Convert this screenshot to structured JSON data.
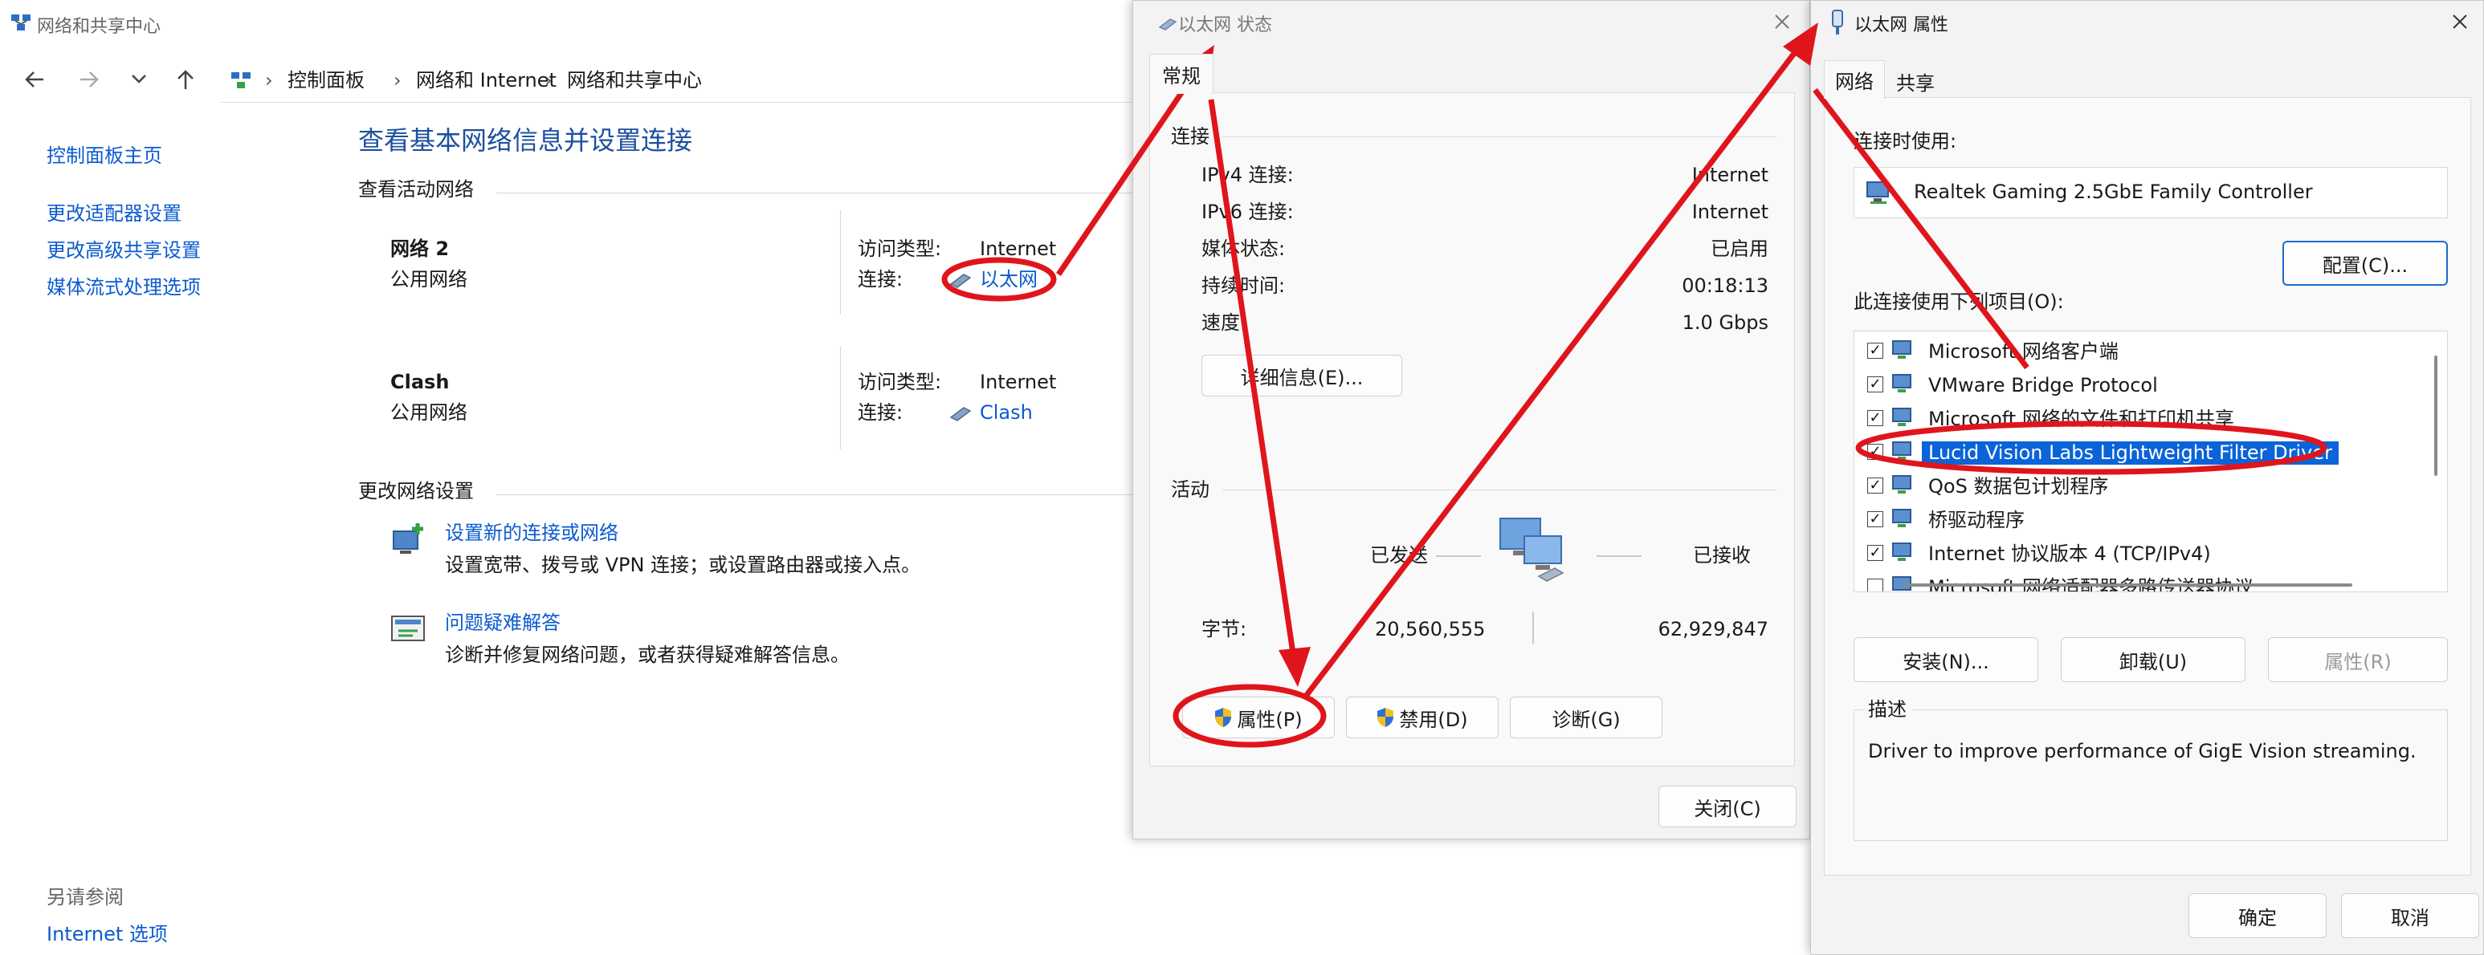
{
  "main": {
    "title": "网络和共享中心",
    "breadcrumb": [
      "控制面板",
      "网络和 Internet",
      "网络和共享中心"
    ],
    "sidebar": {
      "items": [
        "控制面板主页",
        "更改适配器设置",
        "更改高级共享设置",
        "媒体流式处理选项"
      ],
      "see_also_label": "另请参阅",
      "see_also_items": [
        "Internet 选项"
      ]
    },
    "heading": "查看基本网络信息并设置连接",
    "active_label": "查看活动网络",
    "networks": [
      {
        "name": "网络 2",
        "type": "公用网络",
        "access_label": "访问类型:",
        "access": "Internet",
        "conn_label": "连接:",
        "conn": "以太网"
      },
      {
        "name": "Clash",
        "type": "公用网络",
        "access_label": "访问类型:",
        "access": "Internet",
        "conn_label": "连接:",
        "conn": "Clash"
      }
    ],
    "change_label": "更改网络设置",
    "tasks": [
      {
        "title": "设置新的连接或网络",
        "desc": "设置宽带、拨号或 VPN 连接；或设置路由器或接入点。"
      },
      {
        "title": "问题疑难解答",
        "desc": "诊断并修复网络问题，或者获得疑难解答信息。"
      }
    ]
  },
  "status": {
    "title": "以太网 状态",
    "tab": "常规",
    "conn_section": "连接",
    "rows": [
      {
        "label": "IPv4 连接:",
        "value": "Internet"
      },
      {
        "label": "IPv6 连接:",
        "value": "Internet"
      },
      {
        "label": "媒体状态:",
        "value": "已启用"
      },
      {
        "label": "持续时间:",
        "value": "00:18:13"
      },
      {
        "label": "速度:",
        "value": "1.0 Gbps"
      }
    ],
    "details_button": "详细信息(E)...",
    "activity_section": "活动",
    "sent_label": "已发送",
    "received_label": "已接收",
    "bytes_label": "字节:",
    "bytes_sent": "20,560,555",
    "bytes_received": "62,929,847",
    "properties_button": "属性(P)",
    "disable_button": "禁用(D)",
    "diagnose_button": "诊断(G)",
    "close_button": "关闭(C)"
  },
  "props": {
    "title": "以太网 属性",
    "tabs": [
      "网络",
      "共享"
    ],
    "connect_using_label": "连接时使用:",
    "adapter": "Realtek Gaming 2.5GbE Family Controller",
    "configure_button": "配置(C)...",
    "items_label": "此连接使用下列项目(O):",
    "items": [
      {
        "label": "Microsoft 网络客户端",
        "checked": true
      },
      {
        "label": "VMware Bridge Protocol",
        "checked": true
      },
      {
        "label": "Microsoft 网络的文件和打印机共享",
        "checked": true
      },
      {
        "label": "Lucid Vision Labs Lightweight Filter Driver",
        "checked": true
      },
      {
        "label": "QoS 数据包计划程序",
        "checked": true
      },
      {
        "label": "桥驱动程序",
        "checked": true
      },
      {
        "label": "Internet 协议版本 4 (TCP/IPv4)",
        "checked": true
      },
      {
        "label": "Microsoft 网络适配器多路传送器协议",
        "checked": false
      }
    ],
    "install_button": "安装(N)...",
    "uninstall_button": "卸载(U)",
    "properties_button": "属性(R)",
    "description_label": "描述",
    "description": "Driver to improve performance of GigE Vision streaming.",
    "ok_button": "确定",
    "cancel_button": "取消"
  },
  "colors": {
    "link": "#0b5bd0",
    "annotation": "#e0151b",
    "selection": "#0a64d8"
  }
}
